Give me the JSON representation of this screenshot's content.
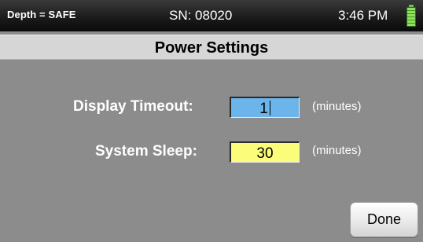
{
  "status_bar": {
    "depth": "Depth = SAFE",
    "serial": "SN: 08020",
    "time": "3:46 PM",
    "battery_icon": "battery-full-icon",
    "battery_color": "#8fe05a"
  },
  "title": "Power Settings",
  "settings": {
    "display_timeout": {
      "label": "Display Timeout:",
      "value": "1",
      "unit": "(minutes)",
      "color": "#6cb5ea"
    },
    "system_sleep": {
      "label": "System Sleep:",
      "value": "30",
      "unit": "(minutes)",
      "color": "#fbfc7a"
    }
  },
  "done_label": "Done",
  "colors": {
    "background": "#8c8c8c",
    "title_bar": "#d6d6d6",
    "status_bar": "#1c1c1c"
  }
}
